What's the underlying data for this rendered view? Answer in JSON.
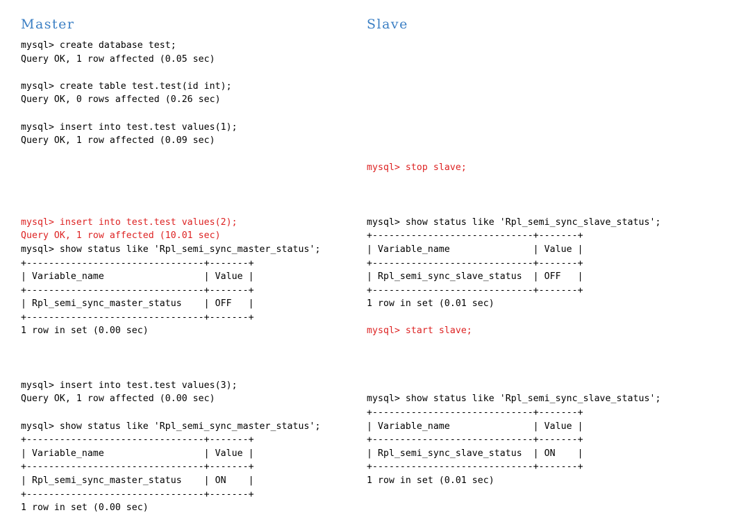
{
  "headings": {
    "master": "Master",
    "slave": "Slave"
  },
  "colors": {
    "heading": "#3b7fc4",
    "normal_text": "#000000",
    "highlight_text": "#dd2222",
    "background": "#ffffff"
  },
  "master_console": [
    {
      "color": "normal",
      "blank_before": 0,
      "lines": [
        "mysql> create database test;",
        "Query OK, 1 row affected (0.05 sec)"
      ]
    },
    {
      "color": "normal",
      "blank_before": 1,
      "lines": [
        "mysql> create table test.test(id int);",
        "Query OK, 0 rows affected (0.26 sec)"
      ]
    },
    {
      "color": "normal",
      "blank_before": 1,
      "lines": [
        "mysql> insert into test.test values(1);",
        "Query OK, 1 row affected (0.09 sec)"
      ]
    },
    {
      "color": "normal",
      "blank_before": 4,
      "lines": [
        ""
      ]
    },
    {
      "color": "highlight",
      "blank_before": 0,
      "lines": [
        "mysql> insert into test.test values(2);",
        "Query OK, 1 row affected (10.01 sec)"
      ]
    },
    {
      "color": "normal",
      "blank_before": 0,
      "lines": [
        "mysql> show status like 'Rpl_semi_sync_master_status';",
        "+--------------------------------+-------+",
        "| Variable_name                  | Value |",
        "+--------------------------------+-------+",
        "| Rpl_semi_sync_master_status    | OFF   |",
        "+--------------------------------+-------+",
        "1 row in set (0.00 sec)"
      ]
    },
    {
      "color": "normal",
      "blank_before": 3,
      "lines": [
        "mysql> insert into test.test values(3);",
        "Query OK, 1 row affected (0.00 sec)"
      ]
    },
    {
      "color": "normal",
      "blank_before": 1,
      "lines": [
        "mysql> show status like 'Rpl_semi_sync_master_status';",
        "+--------------------------------+-------+",
        "| Variable_name                  | Value |",
        "+--------------------------------+-------+",
        "| Rpl_semi_sync_master_status    | ON    |",
        "+--------------------------------+-------+",
        "1 row in set (0.00 sec)"
      ]
    }
  ],
  "slave_console": [
    {
      "color": "normal",
      "blank_before": 8,
      "lines": [
        ""
      ]
    },
    {
      "color": "highlight",
      "blank_before": 0,
      "lines": [
        "mysql> stop slave;"
      ]
    },
    {
      "color": "normal",
      "blank_before": 3,
      "lines": [
        "mysql> show status like 'Rpl_semi_sync_slave_status';",
        "+-----------------------------+-------+",
        "| Variable_name               | Value |",
        "+-----------------------------+-------+",
        "| Rpl_semi_sync_slave_status  | OFF   |",
        "+-----------------------------+-------+",
        "1 row in set (0.01 sec)"
      ]
    },
    {
      "color": "highlight",
      "blank_before": 1,
      "lines": [
        "mysql> start slave;"
      ]
    },
    {
      "color": "normal",
      "blank_before": 4,
      "lines": [
        "mysql> show status like 'Rpl_semi_sync_slave_status';",
        "+-----------------------------+-------+",
        "| Variable_name               | Value |",
        "+-----------------------------+-------+",
        "| Rpl_semi_sync_slave_status  | ON    |",
        "+-----------------------------+-------+",
        "1 row in set (0.01 sec)"
      ]
    }
  ],
  "tables": {
    "master_status_off": {
      "headers": [
        "Variable_name",
        "Value"
      ],
      "rows": [
        [
          "Rpl_semi_sync_master_status",
          "OFF"
        ]
      ],
      "footer": "1 row in set (0.00 sec)"
    },
    "master_status_on": {
      "headers": [
        "Variable_name",
        "Value"
      ],
      "rows": [
        [
          "Rpl_semi_sync_master_status",
          "ON"
        ]
      ],
      "footer": "1 row in set (0.00 sec)"
    },
    "slave_status_off": {
      "headers": [
        "Variable_name",
        "Value"
      ],
      "rows": [
        [
          "Rpl_semi_sync_slave_status",
          "OFF"
        ]
      ],
      "footer": "1 row in set (0.01 sec)"
    },
    "slave_status_on": {
      "headers": [
        "Variable_name",
        "Value"
      ],
      "rows": [
        [
          "Rpl_semi_sync_slave_status",
          "ON"
        ]
      ],
      "footer": "1 row in set (0.01 sec)"
    }
  }
}
